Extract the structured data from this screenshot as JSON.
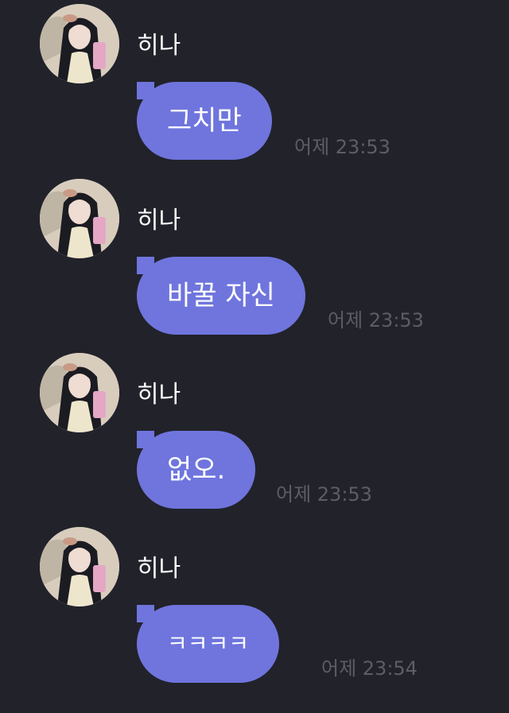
{
  "messages": [
    {
      "sender": "히나",
      "text": "그치만",
      "time": "어제 23:53"
    },
    {
      "sender": "히나",
      "text": "바꿀 자신",
      "time": "어제 23:53"
    },
    {
      "sender": "히나",
      "text": "없오.",
      "time": "어제 23:53"
    },
    {
      "sender": "히나",
      "text": "ㅋㅋㅋㅋ",
      "time": "어제 23:54"
    }
  ],
  "colors": {
    "background": "#22222b",
    "bubble": "#6f75dd",
    "timestamp": "#5d5d66",
    "sender_text": "#ffffff"
  }
}
